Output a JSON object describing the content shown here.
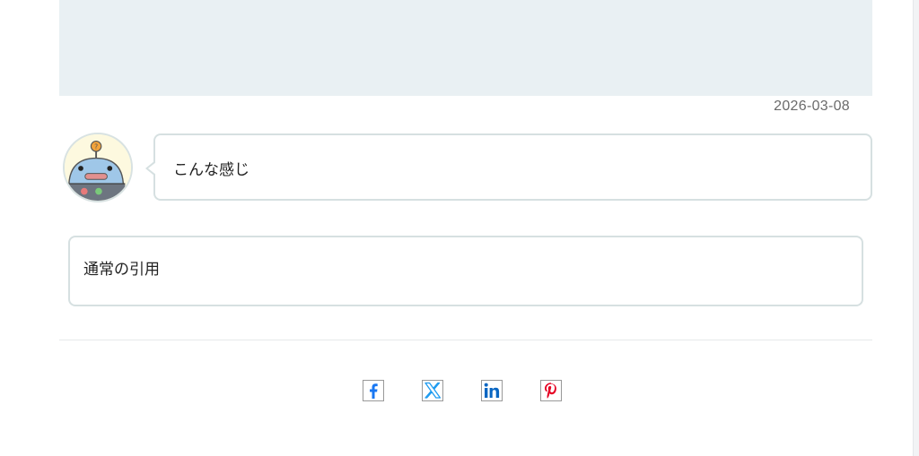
{
  "post": {
    "date": "2026-03-08"
  },
  "speech_bubble": {
    "text": "こんな感じ"
  },
  "blockquote": {
    "text": "通常の引用"
  },
  "share": {
    "buttons": [
      "facebook",
      "x",
      "linkedin",
      "pinterest"
    ],
    "colors": {
      "facebook": "#1877f2",
      "x": "#1d9bf0",
      "linkedin": "#0a66c2",
      "pinterest": "#e60023"
    }
  },
  "colors": {
    "hero_background": "#e9f0f3",
    "bubble_border": "#d6e0e1",
    "avatar_background": "#fdf9df"
  }
}
